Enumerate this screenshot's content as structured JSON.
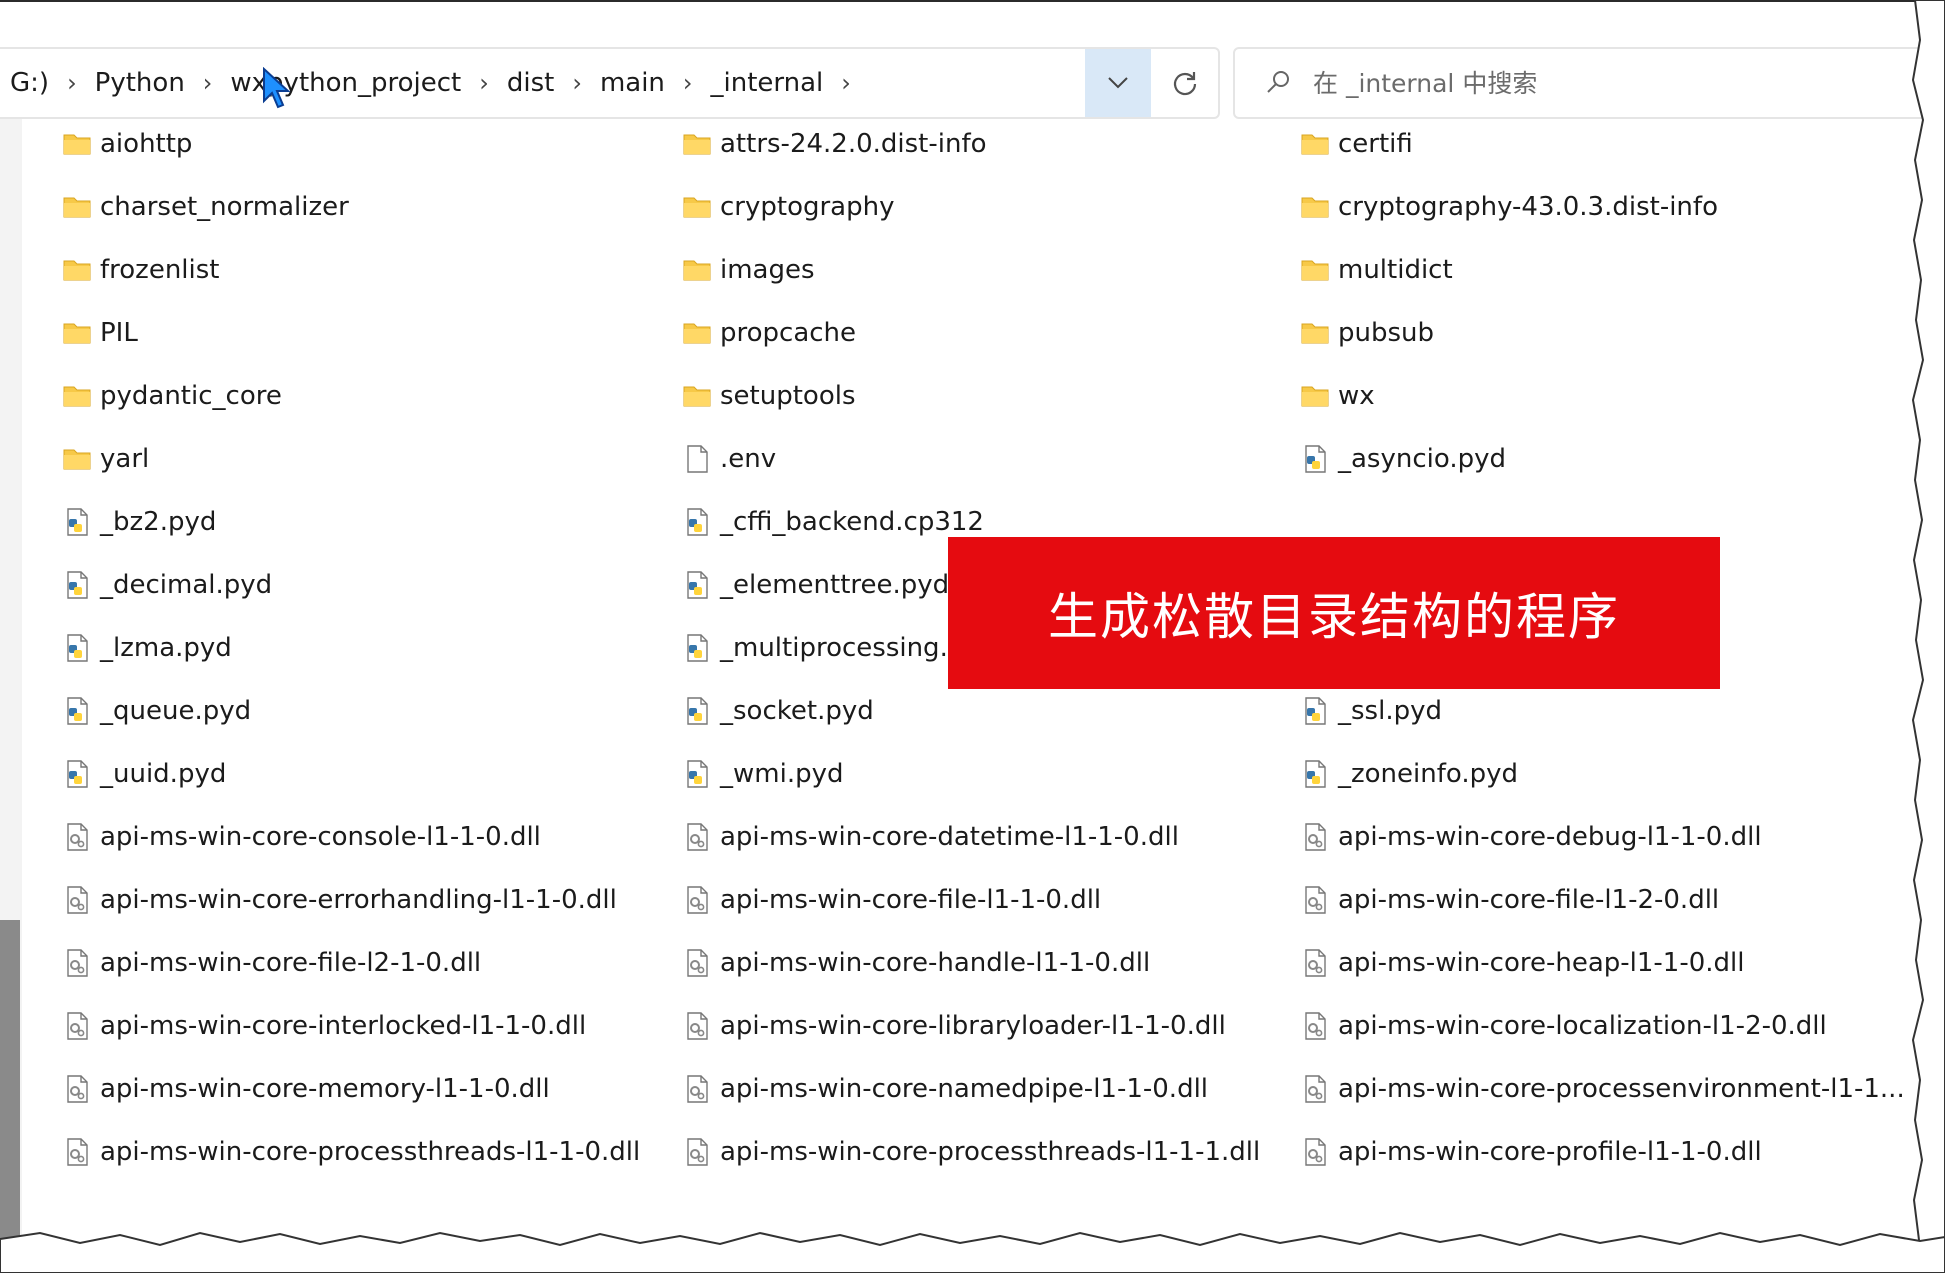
{
  "breadcrumb": {
    "items": [
      "G:)",
      "Python",
      "wxpython_project",
      "dist",
      "main",
      "_internal"
    ]
  },
  "search": {
    "placeholder": "在 _internal 中搜索"
  },
  "overlay": {
    "text": "生成松散目录结构的程序"
  },
  "colors": {
    "banner": "#e50b10",
    "dropdown_highlight": "#d9e8f7",
    "folder": "#f7c948"
  },
  "files": {
    "rows": [
      [
        {
          "name": "aiohttp",
          "type": "folder"
        },
        {
          "name": "attrs-24.2.0.dist-info",
          "type": "folder"
        },
        {
          "name": "certifi",
          "type": "folder"
        }
      ],
      [
        {
          "name": "charset_normalizer",
          "type": "folder"
        },
        {
          "name": "cryptography",
          "type": "folder"
        },
        {
          "name": "cryptography-43.0.3.dist-info",
          "type": "folder"
        }
      ],
      [
        {
          "name": "frozenlist",
          "type": "folder"
        },
        {
          "name": "images",
          "type": "folder"
        },
        {
          "name": "multidict",
          "type": "folder"
        }
      ],
      [
        {
          "name": "PIL",
          "type": "folder"
        },
        {
          "name": "propcache",
          "type": "folder"
        },
        {
          "name": "pubsub",
          "type": "folder"
        }
      ],
      [
        {
          "name": "pydantic_core",
          "type": "folder"
        },
        {
          "name": "setuptools",
          "type": "folder"
        },
        {
          "name": "wx",
          "type": "folder"
        }
      ],
      [
        {
          "name": "yarl",
          "type": "folder"
        },
        {
          "name": ".env",
          "type": "file"
        },
        {
          "name": "_asyncio.pyd",
          "type": "pyd"
        }
      ],
      [
        {
          "name": "_bz2.pyd",
          "type": "pyd"
        },
        {
          "name": "_cffi_backend.cp312",
          "type": "pyd"
        },
        {
          "name": "",
          "type": "none"
        }
      ],
      [
        {
          "name": "_decimal.pyd",
          "type": "pyd"
        },
        {
          "name": "_elementtree.pyd",
          "type": "pyd"
        },
        {
          "name": "",
          "type": "none"
        }
      ],
      [
        {
          "name": "_lzma.pyd",
          "type": "pyd"
        },
        {
          "name": "_multiprocessing.py",
          "type": "pyd"
        },
        {
          "name": "",
          "type": "none"
        }
      ],
      [
        {
          "name": "_queue.pyd",
          "type": "pyd"
        },
        {
          "name": "_socket.pyd",
          "type": "pyd"
        },
        {
          "name": "_ssl.pyd",
          "type": "pyd"
        }
      ],
      [
        {
          "name": "_uuid.pyd",
          "type": "pyd"
        },
        {
          "name": "_wmi.pyd",
          "type": "pyd"
        },
        {
          "name": "_zoneinfo.pyd",
          "type": "pyd"
        }
      ],
      [
        {
          "name": "api-ms-win-core-console-l1-1-0.dll",
          "type": "dll"
        },
        {
          "name": "api-ms-win-core-datetime-l1-1-0.dll",
          "type": "dll"
        },
        {
          "name": "api-ms-win-core-debug-l1-1-0.dll",
          "type": "dll"
        }
      ],
      [
        {
          "name": "api-ms-win-core-errorhandling-l1-1-0.dll",
          "type": "dll"
        },
        {
          "name": "api-ms-win-core-file-l1-1-0.dll",
          "type": "dll"
        },
        {
          "name": "api-ms-win-core-file-l1-2-0.dll",
          "type": "dll"
        }
      ],
      [
        {
          "name": "api-ms-win-core-file-l2-1-0.dll",
          "type": "dll"
        },
        {
          "name": "api-ms-win-core-handle-l1-1-0.dll",
          "type": "dll"
        },
        {
          "name": "api-ms-win-core-heap-l1-1-0.dll",
          "type": "dll"
        }
      ],
      [
        {
          "name": "api-ms-win-core-interlocked-l1-1-0.dll",
          "type": "dll"
        },
        {
          "name": "api-ms-win-core-libraryloader-l1-1-0.dll",
          "type": "dll"
        },
        {
          "name": "api-ms-win-core-localization-l1-2-0.dll",
          "type": "dll"
        }
      ],
      [
        {
          "name": "api-ms-win-core-memory-l1-1-0.dll",
          "type": "dll"
        },
        {
          "name": "api-ms-win-core-namedpipe-l1-1-0.dll",
          "type": "dll"
        },
        {
          "name": "api-ms-win-core-processenvironment-l1-1...",
          "type": "dll"
        }
      ],
      [
        {
          "name": "api-ms-win-core-processthreads-l1-1-0.dll",
          "type": "dll"
        },
        {
          "name": "api-ms-win-core-processthreads-l1-1-1.dll",
          "type": "dll"
        },
        {
          "name": "api-ms-win-core-profile-l1-1-0.dll",
          "type": "dll"
        }
      ]
    ]
  }
}
